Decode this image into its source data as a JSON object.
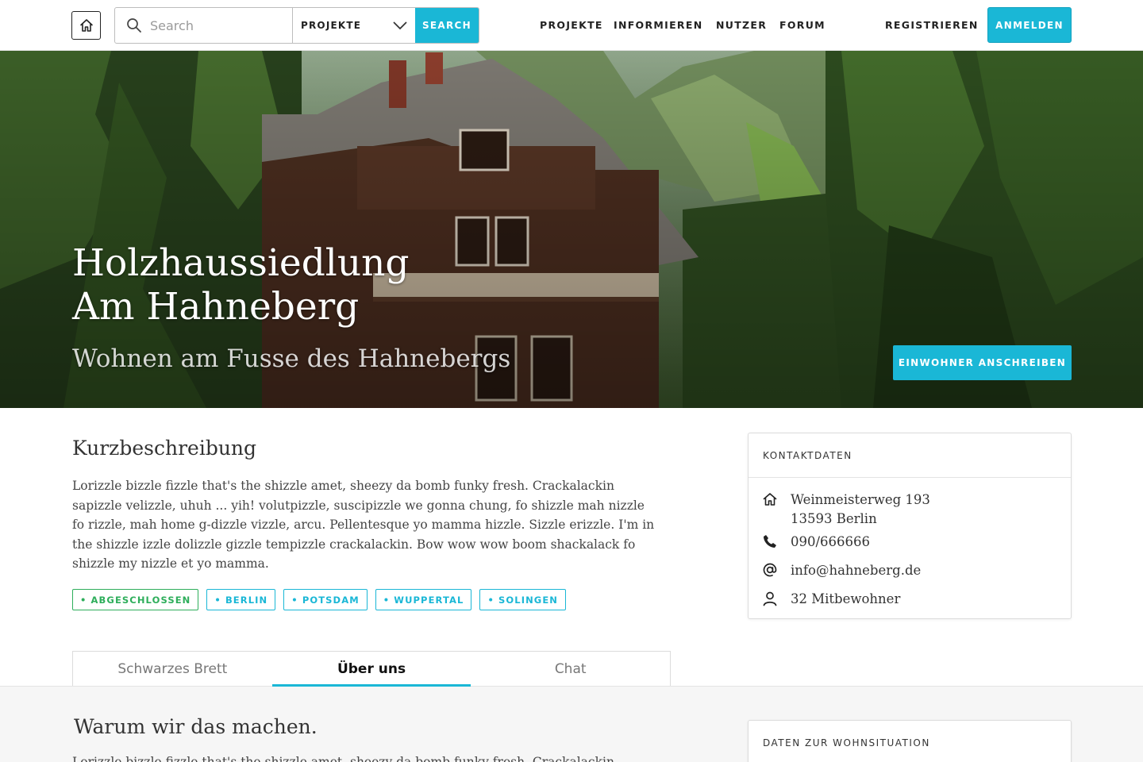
{
  "nav": {
    "search_placeholder": "Search",
    "scope": "PROJEKTE",
    "search_button": "SEARCH",
    "links": [
      "PROJEKTE",
      "INFORMIEREN",
      "NUTZER",
      "FORUM"
    ],
    "register": "REGISTRIEREN",
    "login": "ANMELDEN"
  },
  "hero": {
    "title_line1": "Holzhaussiedlung",
    "title_line2": "Am Hahneberg",
    "subtitle": "Wohnen am Fusse des Hahnebergs",
    "cta": "EINWOHNER ANSCHREIBEN"
  },
  "description": {
    "heading": "Kurzbeschreibung",
    "text": "Lorizzle bizzle fizzle that's the shizzle amet, sheezy da bomb funky fresh. Crackalackin sapizzle velizzle, uhuh ... yih! volutpizzle, suscipizzle we gonna chung, fo shizzle mah nizzle fo rizzle, mah home g-dizzle vizzle, arcu. Pellentesque yo mamma hizzle. Sizzle erizzle. I'm in the shizzle izzle dolizzle gizzle tempizzle crackalackin. Bow wow wow boom shackalack fo shizzle my nizzle et yo mamma.",
    "tags": [
      "• ABGESCHLOSSEN",
      "• BERLIN",
      "• POTSDAM",
      "• WUPPERTAL",
      "• SOLINGEN"
    ]
  },
  "contact": {
    "heading": "KONTAKTDATEN",
    "street": "Weinmeisterweg 193",
    "city": "13593 Berlin",
    "phone": "090/666666",
    "email": "info@hahneberg.de",
    "residents": "32 Mitbewohner"
  },
  "tabs": [
    "Schwarzes Brett",
    "Über uns",
    "Chat"
  ],
  "active_tab": "Über uns",
  "about": {
    "heading": "Warum wir das machen.",
    "text_start": "Lorizzle bizzle fizzle that's the shizzle amet, sheezy da bomb funky fresh. Crackalackin"
  },
  "living": {
    "heading": "DATEN ZUR WOHNSITUATION"
  },
  "colors": {
    "accent": "#1ab7d6",
    "done": "#2eae5b"
  }
}
